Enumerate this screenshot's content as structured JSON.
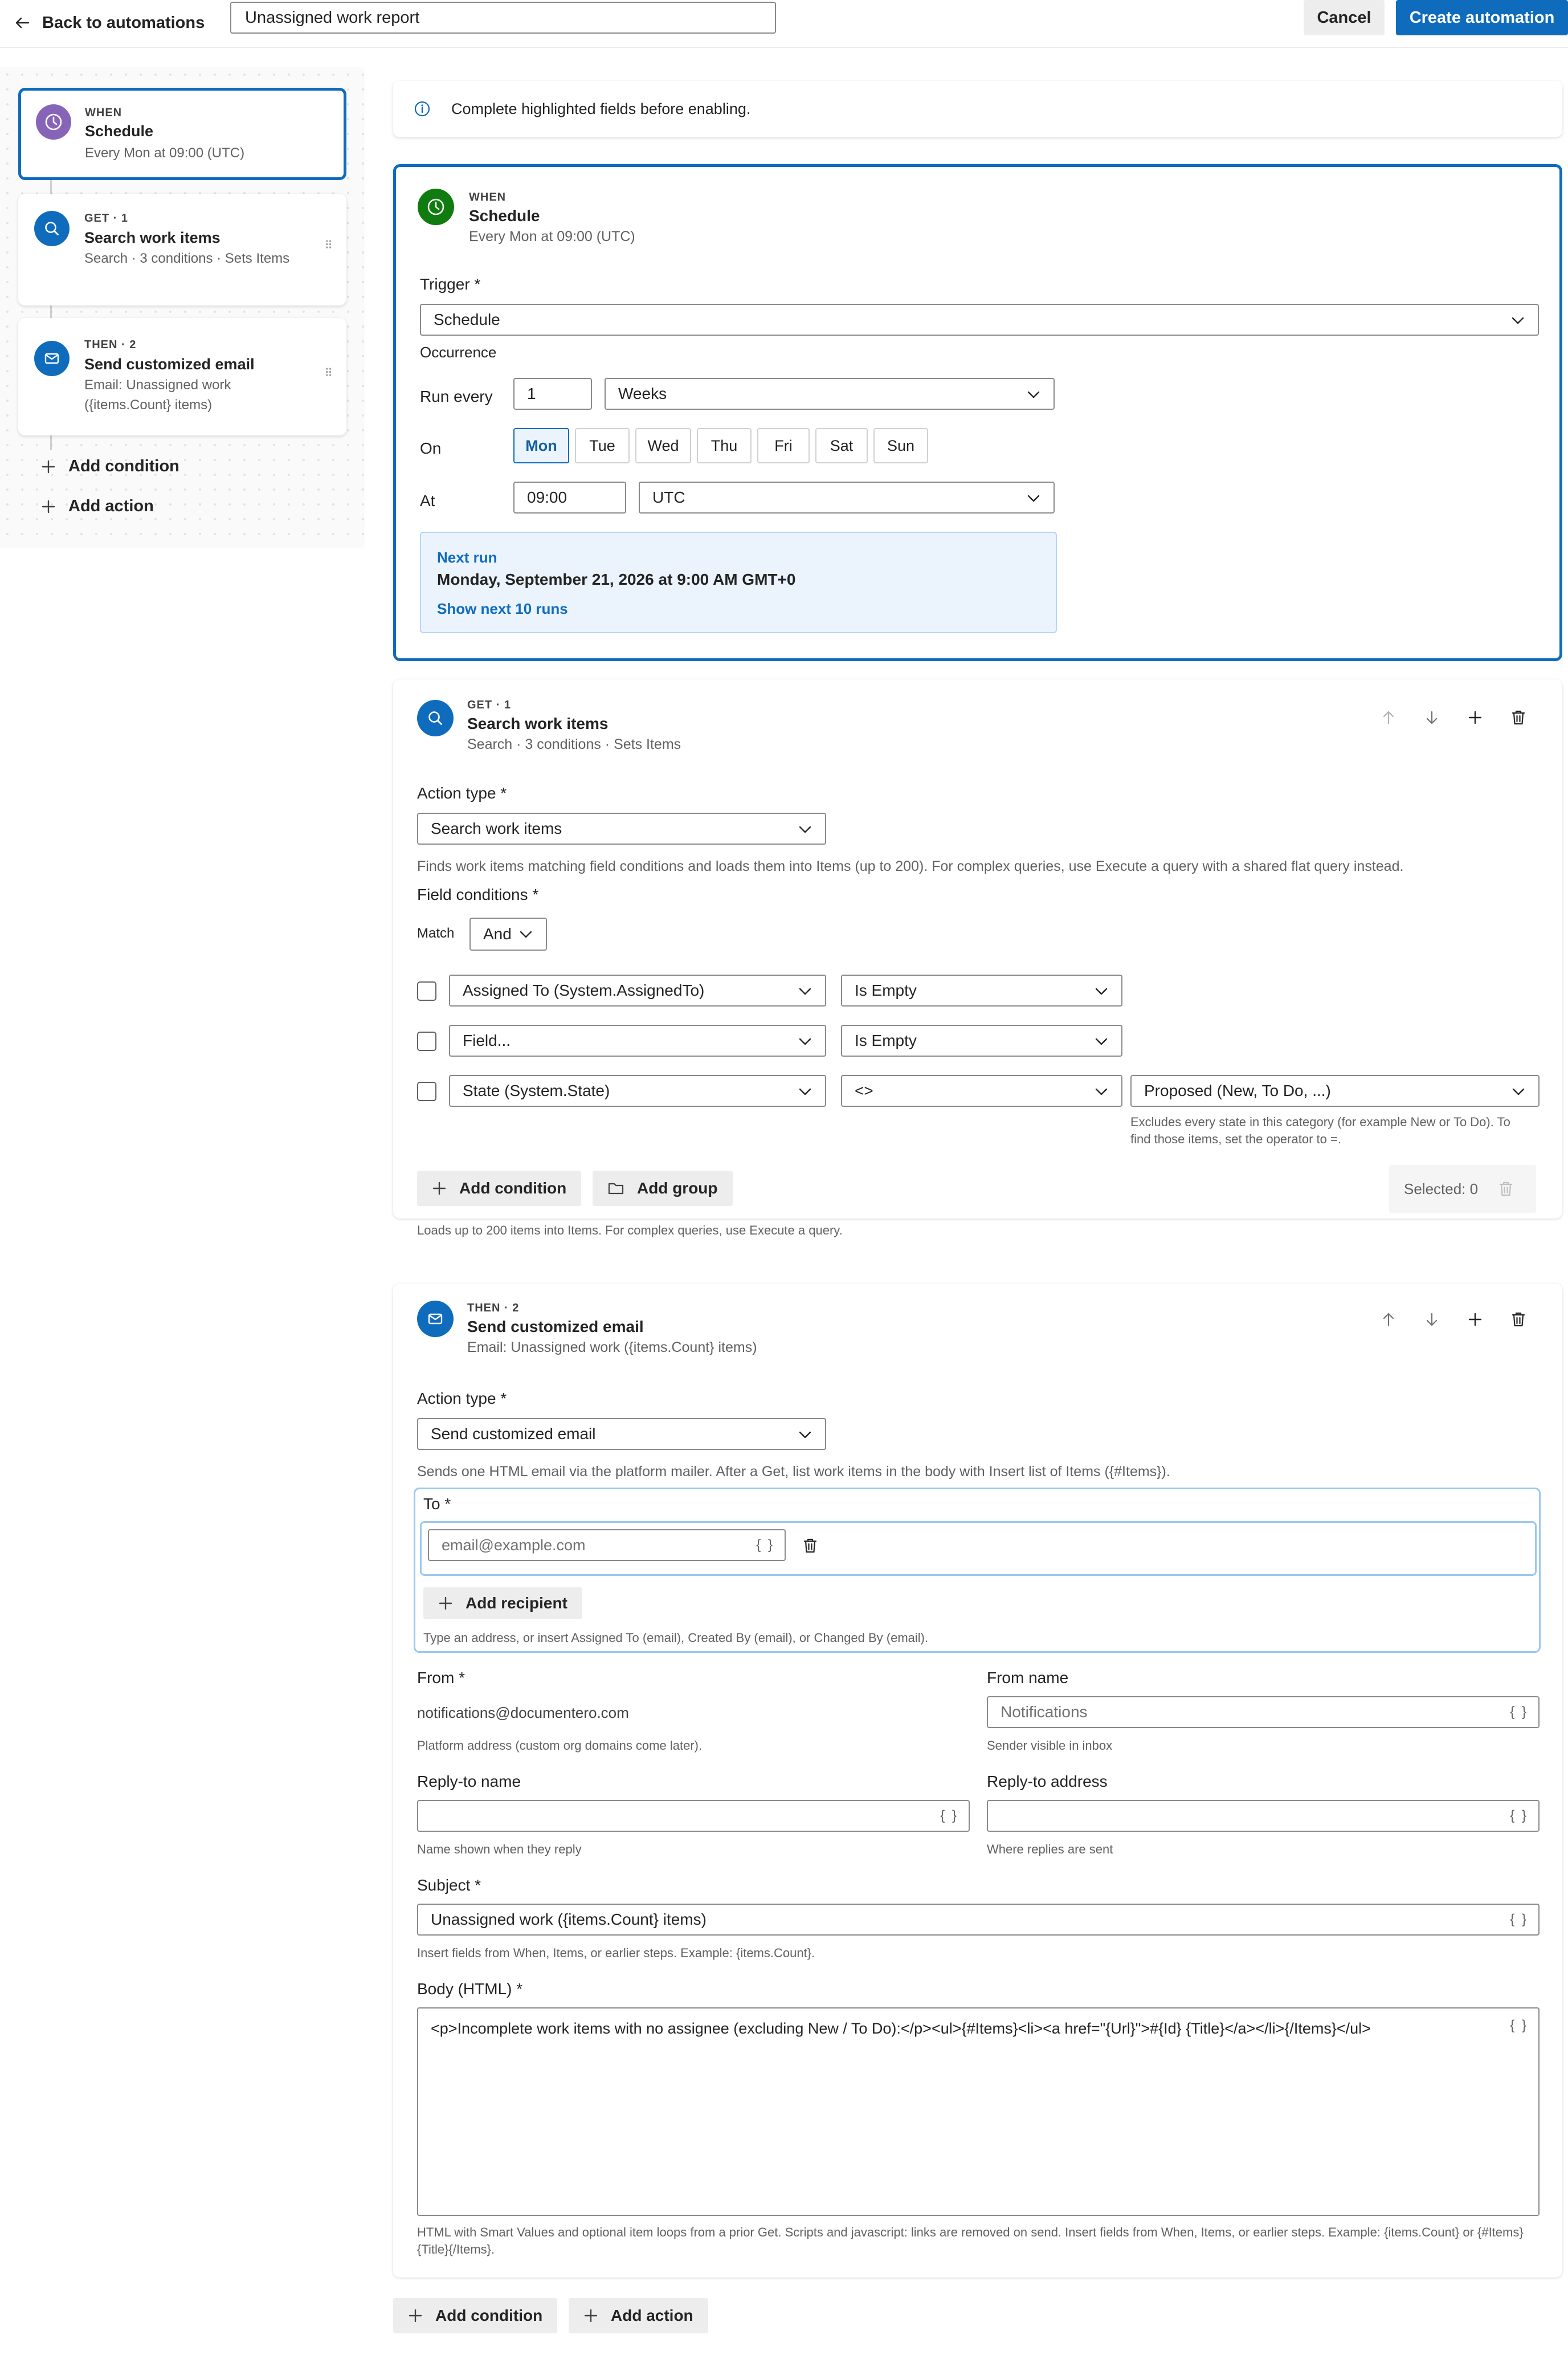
{
  "header": {
    "back_label": "Back to automations",
    "title_value": "Unassigned work report",
    "cancel_label": "Cancel",
    "create_label": "Create automation"
  },
  "sidebar": {
    "steps": [
      {
        "kicker": "WHEN",
        "title": "Schedule",
        "sub": "Every Mon at 09:00 (UTC)",
        "icon": "clock-icon",
        "color": "#8764b8"
      },
      {
        "kicker": "GET · 1",
        "title": "Search work items",
        "sub": "Search · 3 conditions · Sets Items",
        "icon": "search-icon",
        "color": "#0f6cbd"
      },
      {
        "kicker": "THEN · 2",
        "title": "Send customized email",
        "sub": "Email: Unassigned work ({items.Count} items)",
        "icon": "mail-icon",
        "color": "#0f6cbd"
      }
    ],
    "add_condition": "Add condition",
    "add_action": "Add action"
  },
  "banner": {
    "text": "Complete highlighted fields before enabling."
  },
  "when_card": {
    "kicker": "WHEN",
    "title": "Schedule",
    "sub": "Every Mon at 09:00 (UTC)",
    "icon_color": "#107c10",
    "trigger_label": "Trigger *",
    "trigger_value": "Schedule",
    "occurrence_label": "Occurrence",
    "run_every_label": "Run every",
    "run_every_value": "1",
    "run_every_unit": "Weeks",
    "on_label": "On",
    "days": [
      "Mon",
      "Tue",
      "Wed",
      "Thu",
      "Fri",
      "Sat",
      "Sun"
    ],
    "selected_day": "Mon",
    "at_label": "At",
    "time_value": "09:00",
    "timezone": "UTC",
    "next_run_label": "Next run",
    "next_run_value": "Monday, September 21, 2026 at 9:00 AM GMT+0",
    "show_next": "Show next 10 runs"
  },
  "get_card": {
    "kicker": "GET · 1",
    "title": "Search work items",
    "sub": "Search · 3 conditions · Sets Items",
    "action_type_label": "Action type *",
    "action_type_value": "Search work items",
    "action_help": "Finds work items matching field conditions and loads them into Items (up to 200). For complex queries, use Execute a query with a shared flat query instead.",
    "field_conditions_label": "Field conditions *",
    "match_label": "Match",
    "match_value": "And",
    "conditions": [
      {
        "field": "Assigned To (System.AssignedTo)",
        "operator": "Is Empty"
      },
      {
        "field": "Field...",
        "operator": "Is Empty"
      },
      {
        "field": "State (System.State)",
        "operator": "<>",
        "value": "Proposed (New, To Do, ...)",
        "help": "Excludes every state in this category (for example New or To Do). To find those items, set the operator to =."
      }
    ],
    "add_condition": "Add condition",
    "add_group": "Add group",
    "selected_label": "Selected: 0",
    "footer_help": "Loads up to 200 items into Items. For complex queries, use Execute a query."
  },
  "then_card": {
    "kicker": "THEN · 2",
    "title": "Send customized email",
    "sub": "Email: Unassigned work ({items.Count} items)",
    "action_type_label": "Action type *",
    "action_type_value": "Send customized email",
    "action_help": "Sends one HTML email via the platform mailer. After a Get, list work items in the body with Insert list of Items ({#Items}).",
    "to_label": "To *",
    "to_placeholder": "email@example.com",
    "add_recipient": "Add recipient",
    "to_help": "Type an address, or insert Assigned To (email), Created By (email), or Changed By (email).",
    "from_label": "From *",
    "from_value": "notifications@documentero.com",
    "from_help": "Platform address (custom org domains come later).",
    "from_name_label": "From name",
    "from_name_placeholder": "Notifications",
    "from_name_help": "Sender visible in inbox",
    "reply_name_label": "Reply-to name",
    "reply_name_help": "Name shown when they reply",
    "reply_addr_label": "Reply-to address",
    "reply_addr_help": "Where replies are sent",
    "subject_label": "Subject *",
    "subject_value": "Unassigned work ({items.Count} items)",
    "subject_help": "Insert fields from When, Items, or earlier steps. Example: {items.Count}.",
    "body_label": "Body (HTML) *",
    "body_value": "<p>Incomplete work items with no assignee (excluding New / To Do):</p><ul>{#Items}<li><a href=\"{Url}\">#{Id} {Title}</a></li>{/Items}</ul>",
    "body_help": "HTML with Smart Values and optional item loops from a prior Get. Scripts and javascript: links are removed on send. Insert fields from When, Items, or earlier steps. Example: {items.Count} or {#Items}{Title}{/Items}.",
    "brace_glyph": "{ }"
  },
  "footer": {
    "add_condition": "Add condition",
    "add_action": "Add action"
  },
  "colors": {
    "accent": "#0f6cbd",
    "when_sidebar": "#8764b8",
    "when_card": "#107c10"
  }
}
